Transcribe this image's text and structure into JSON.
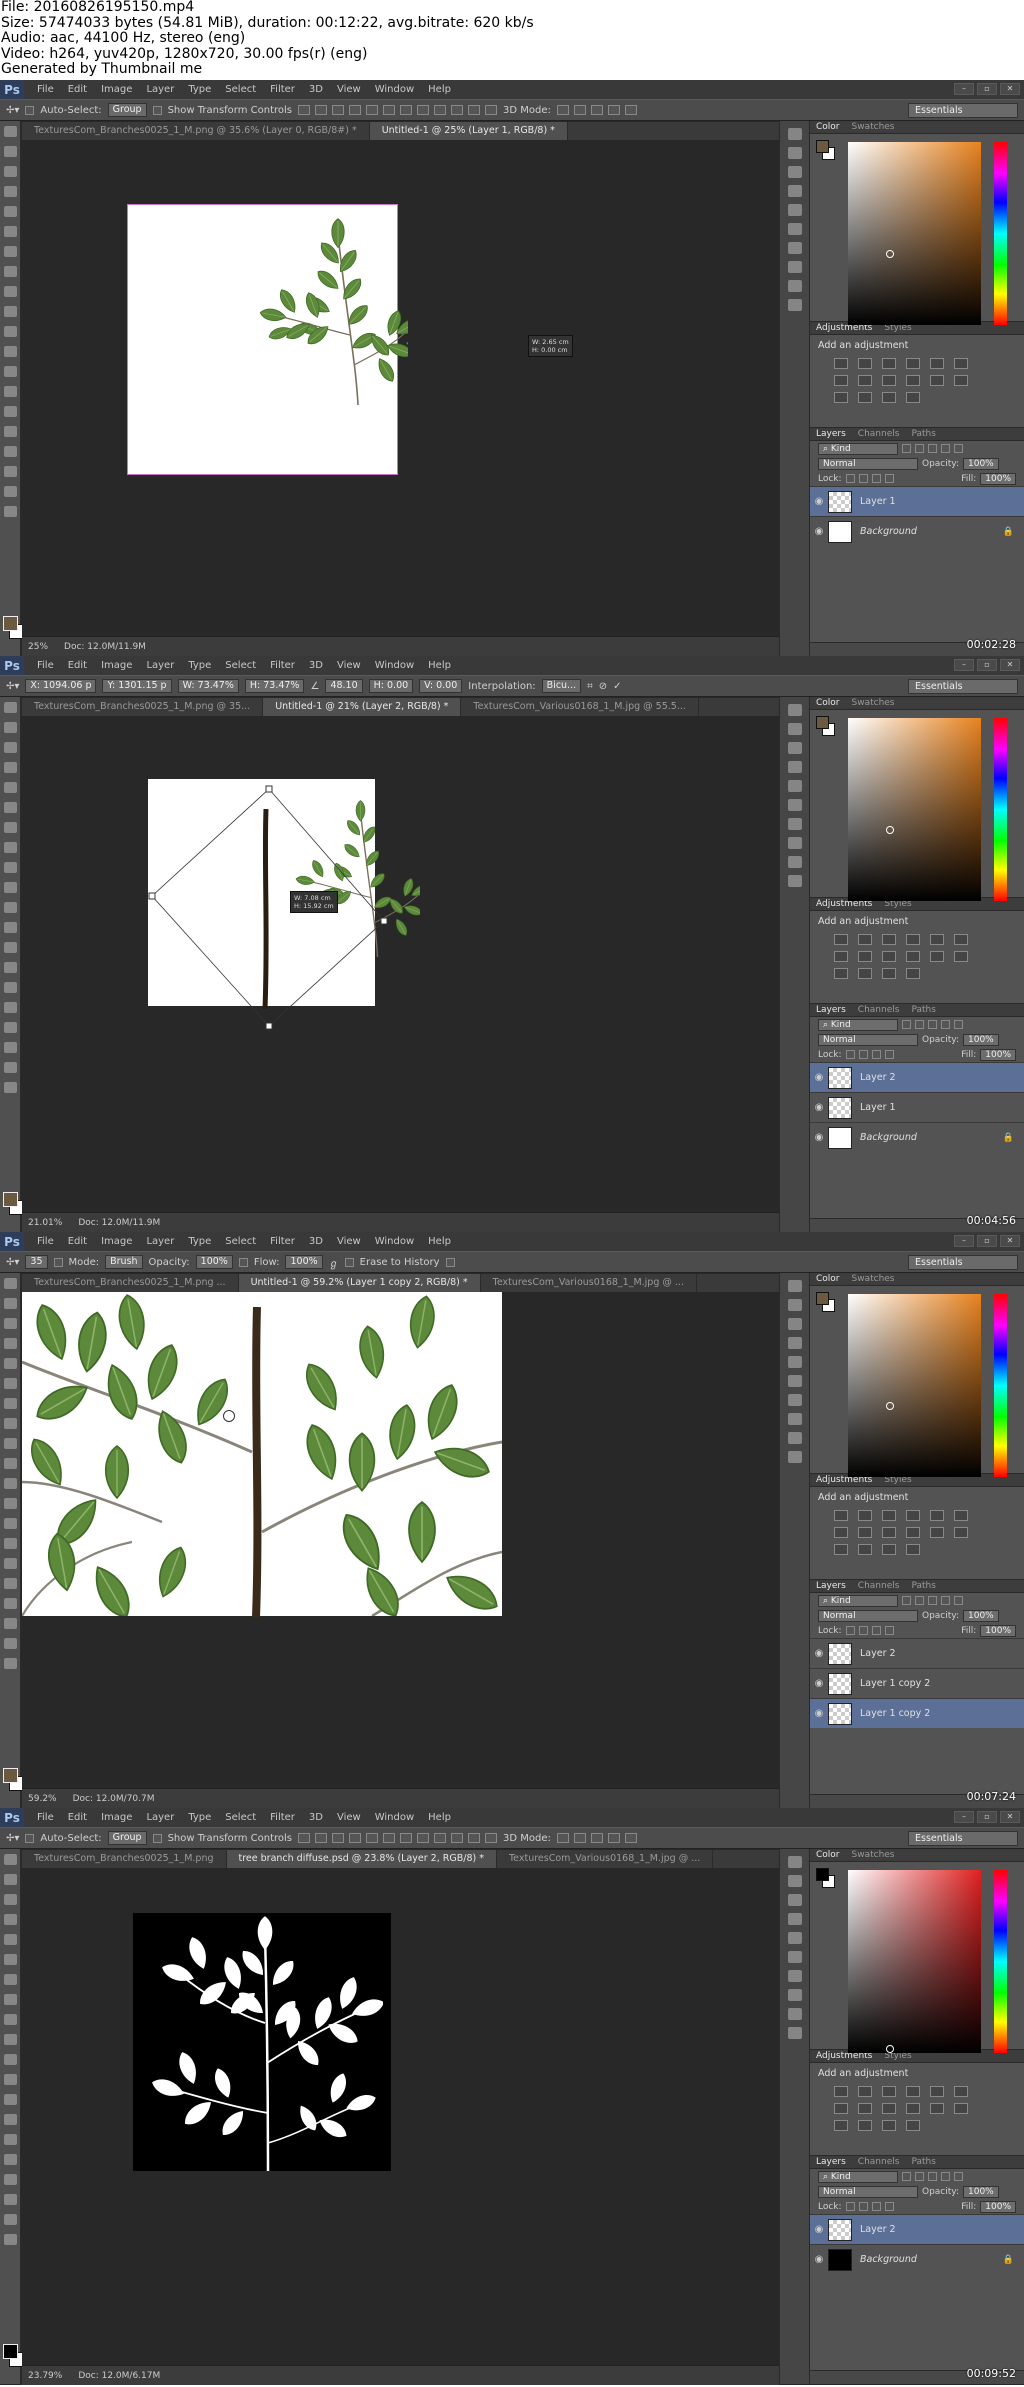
{
  "header": {
    "lines": [
      "File: 20160826195150.mp4",
      "Size: 57474033 bytes (54.81 MiB), duration: 00:12:22, avg.bitrate: 620 kb/s",
      "Audio: aac, 44100 Hz, stereo (eng)",
      "Video: h264, yuv420p, 1280x720, 30.00 fps(r) (eng)",
      "Generated by Thumbnail me"
    ]
  },
  "menu": [
    "File",
    "Edit",
    "Image",
    "Layer",
    "Type",
    "Select",
    "Filter",
    "3D",
    "View",
    "Window",
    "Help"
  ],
  "ps_logo": "Ps",
  "workspace": "Essentials",
  "panels": {
    "color_tab": "Color",
    "swatches_tab": "Swatches",
    "adjustments_tab": "Adjustments",
    "styles_tab": "Styles",
    "add_adjustment": "Add an adjustment",
    "layers_tab": "Layers",
    "channels_tab": "Channels",
    "paths_tab": "Paths",
    "kind": "Kind",
    "blend": "Normal",
    "opacity_label": "Opacity:",
    "opacity": "100%",
    "lock_label": "Lock:",
    "fill_label": "Fill:",
    "fill": "100%"
  },
  "frames": [
    {
      "options": {
        "auto_select": "Auto-Select:",
        "group": "Group",
        "transform": "Show Transform Controls",
        "mode3d": "3D Mode:"
      },
      "tabs": [
        "TexturesCom_Branches0025_1_M.png @ 35.6% (Layer 0, RGB/8#) *",
        "Untitled-1 @ 25% (Layer 1, RGB/8) *"
      ],
      "active_tab": 1,
      "zoom": "25%",
      "doc": "Doc: 12.0M/11.9M",
      "timestamp": "00:02:28",
      "tooltip": [
        "W: 2.65 cm",
        "H: 0.00 cm"
      ],
      "layers": [
        {
          "name": "Layer 1",
          "selected": true,
          "background": false
        },
        {
          "name": "Background",
          "selected": false,
          "background": true
        }
      ],
      "fg": "#6b5a40"
    },
    {
      "options": {
        "x": "X: 1094.06 p",
        "y": "Y: 1301.15 p",
        "w": "W: 73.47%",
        "h": "H: 73.47%",
        "angle": "48.10",
        "hskew": "H: 0.00",
        "vskew": "V: 0.00",
        "interp_label": "Interpolation:",
        "interp": "Bicu..."
      },
      "tabs": [
        "TexturesCom_Branches0025_1_M.png @ 35...",
        "Untitled-1 @ 21% (Layer 2, RGB/8) *",
        "TexturesCom_Various0168_1_M.jpg @ 55.5..."
      ],
      "active_tab": 1,
      "zoom": "21.01%",
      "doc": "Doc: 12.0M/11.9M",
      "timestamp": "00:04:56",
      "tooltip": [
        "W: 7.08 cm",
        "H: 15.92 cm"
      ],
      "layers": [
        {
          "name": "Layer 2",
          "selected": true,
          "background": false
        },
        {
          "name": "Layer 1",
          "selected": false,
          "background": false
        },
        {
          "name": "Background",
          "selected": false,
          "background": true
        }
      ],
      "fg": "#6b5a40"
    },
    {
      "options": {
        "mode_label": "Mode:",
        "mode": "Brush",
        "opacity_label": "Opacity:",
        "opacity": "100%",
        "flow_label": "Flow:",
        "flow": "100%",
        "erase": "Erase to History",
        "size": "35"
      },
      "tabs": [
        "TexturesCom_Branches0025_1_M.png ...",
        "Untitled-1 @ 59.2% (Layer 1 copy 2, RGB/8) *",
        "TexturesCom_Various0168_1_M.jpg @ ..."
      ],
      "active_tab": 1,
      "zoom": "59.2%",
      "doc": "Doc: 12.0M/70.7M",
      "timestamp": "00:07:24",
      "layers": [
        {
          "name": "Layer 2",
          "selected": false,
          "background": false
        },
        {
          "name": "Layer 1 copy 2",
          "selected": false,
          "background": false
        },
        {
          "name": "Layer 1 copy 2",
          "selected": true,
          "background": false
        }
      ],
      "fg": "#6b5a40"
    },
    {
      "options": {
        "auto_select": "Auto-Select:",
        "group": "Group",
        "transform": "Show Transform Controls",
        "mode3d": "3D Mode:"
      },
      "tabs": [
        "TexturesCom_Branches0025_1_M.png",
        "tree branch diffuse.psd @ 23.8% (Layer 2, RGB/8) *",
        "TexturesCom_Various0168_1_M.jpg @ ..."
      ],
      "active_tab": 1,
      "zoom": "23.79%",
      "doc": "Doc: 12.0M/6.17M",
      "timestamp": "00:09:52",
      "layers": [
        {
          "name": "Layer 2",
          "selected": true,
          "background": false
        },
        {
          "name": "Background",
          "selected": false,
          "background": true
        }
      ],
      "fg": "#000000"
    }
  ]
}
